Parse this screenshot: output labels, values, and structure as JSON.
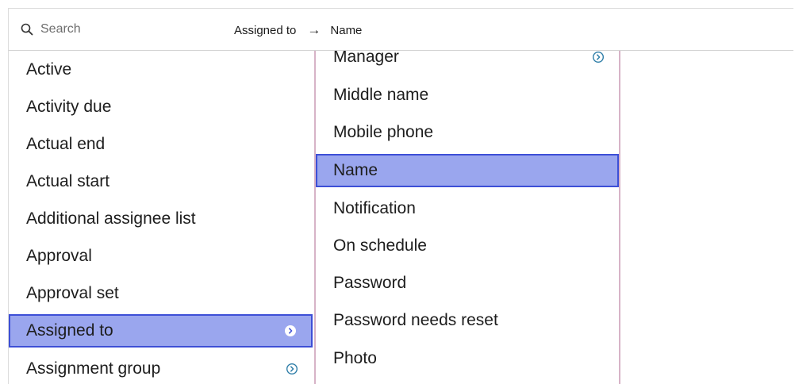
{
  "topbar": {
    "search_placeholder": "Search",
    "breadcrumb": {
      "parent": "Assigned to",
      "arrow": "→",
      "child": "Name"
    }
  },
  "left_list": {
    "items": [
      {
        "label": "Active",
        "has_children": false,
        "selected": false
      },
      {
        "label": "Activity due",
        "has_children": false,
        "selected": false
      },
      {
        "label": "Actual end",
        "has_children": false,
        "selected": false
      },
      {
        "label": "Actual start",
        "has_children": false,
        "selected": false
      },
      {
        "label": "Additional assignee list",
        "has_children": false,
        "selected": false
      },
      {
        "label": "Approval",
        "has_children": false,
        "selected": false
      },
      {
        "label": "Approval set",
        "has_children": false,
        "selected": false
      },
      {
        "label": "Assigned to",
        "has_children": true,
        "selected": true
      },
      {
        "label": "Assignment group",
        "has_children": true,
        "selected": false
      }
    ]
  },
  "right_list": {
    "items": [
      {
        "label": "Manager",
        "has_children": true,
        "selected": false
      },
      {
        "label": "Middle name",
        "has_children": false,
        "selected": false
      },
      {
        "label": "Mobile phone",
        "has_children": false,
        "selected": false
      },
      {
        "label": "Name",
        "has_children": false,
        "selected": true
      },
      {
        "label": "Notification",
        "has_children": false,
        "selected": false
      },
      {
        "label": "On schedule",
        "has_children": false,
        "selected": false
      },
      {
        "label": "Password",
        "has_children": false,
        "selected": false
      },
      {
        "label": "Password needs reset",
        "has_children": false,
        "selected": false
      },
      {
        "label": "Photo",
        "has_children": false,
        "selected": false
      }
    ]
  },
  "colors": {
    "selected_bg": "#9aa6ee",
    "selected_border": "#3d4fd6",
    "column_divider": "#d7b3c7",
    "expand_icon": "#2f7ea8"
  },
  "icons": {
    "search": "search-icon",
    "expand": "chevron-right-circle-icon",
    "breadcrumb_arrow": "arrow-right-icon"
  }
}
